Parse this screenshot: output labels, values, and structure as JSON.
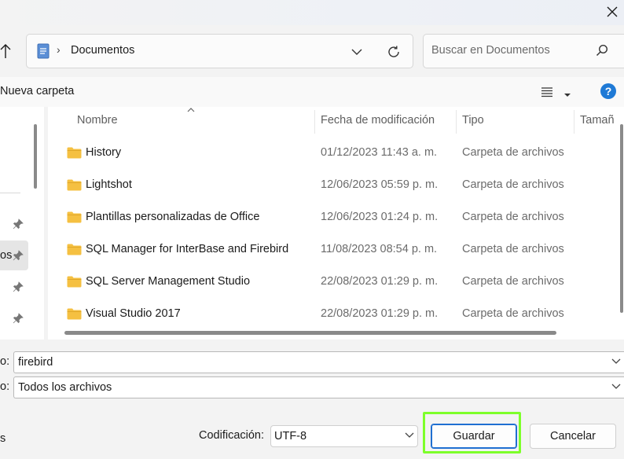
{
  "window": {
    "close_label": "✕"
  },
  "address": {
    "breadcrumb_sep": "›",
    "location": "Documentos"
  },
  "search": {
    "placeholder": "Buscar en Documentos"
  },
  "toolbar": {
    "new_folder_label": "Nueva carpeta",
    "help_label": "?"
  },
  "nav": {
    "items": [
      {
        "label": ""
      },
      {
        "label": "os"
      },
      {
        "label": ""
      },
      {
        "label": ""
      }
    ]
  },
  "columns": {
    "name": "Nombre",
    "modified": "Fecha de modificación",
    "type": "Tipo",
    "size": "Tamañ"
  },
  "files": [
    {
      "name": "History",
      "modified": "01/12/2023 11:43 a. m.",
      "type": "Carpeta de archivos"
    },
    {
      "name": "Lightshot",
      "modified": "12/06/2023 05:59 p. m.",
      "type": "Carpeta de archivos"
    },
    {
      "name": "Plantillas personalizadas de Office",
      "modified": "12/06/2023 01:24 p. m.",
      "type": "Carpeta de archivos"
    },
    {
      "name": "SQL Manager for InterBase and Firebird",
      "modified": "11/08/2023 08:54 p. m.",
      "type": "Carpeta de archivos"
    },
    {
      "name": "SQL Server Management Studio",
      "modified": "22/08/2023 01:29 p. m.",
      "type": "Carpeta de archivos"
    },
    {
      "name": "Visual Studio 2017",
      "modified": "22/08/2023 01:29 p. m.",
      "type": "Carpeta de archivos"
    }
  ],
  "fields": {
    "filename_label": "o:",
    "filename_value": "firebird",
    "filetype_label": "o:",
    "filetype_value": "Todos los archivos"
  },
  "footer": {
    "left_label": "s",
    "encoding_label": "Codificación:",
    "encoding_value": "UTF-8",
    "save_label": "Guardar",
    "cancel_label": "Cancelar"
  },
  "colors": {
    "accent": "#1f6fd1",
    "highlight": "#7dff2a",
    "folder": "#f5c041"
  }
}
